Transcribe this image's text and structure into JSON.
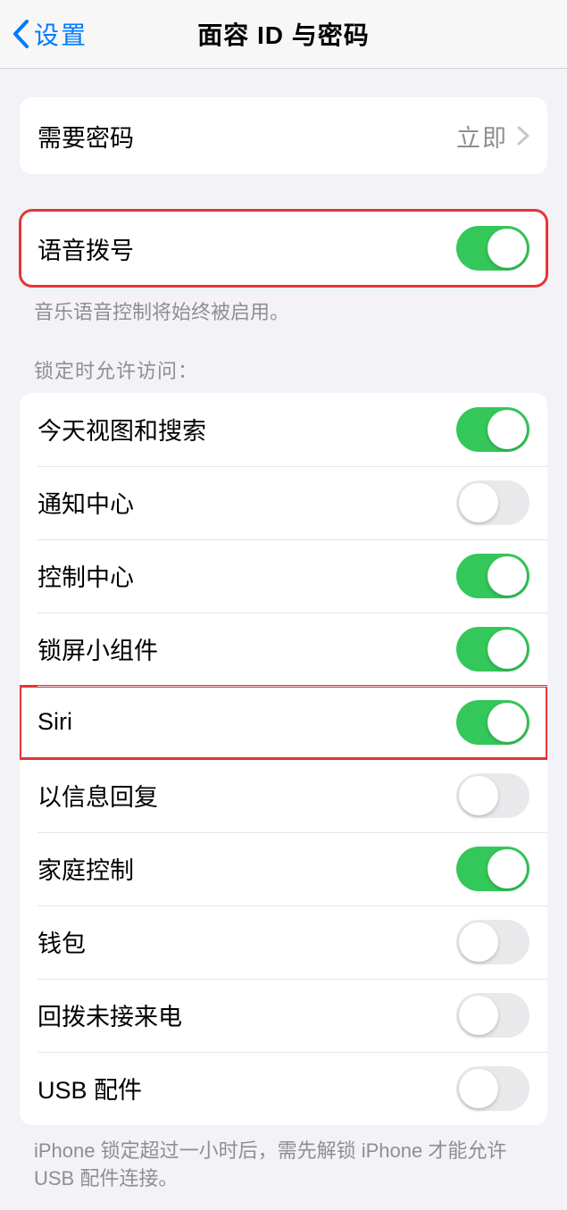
{
  "header": {
    "back_label": "设置",
    "title": "面容 ID 与密码"
  },
  "require_passcode_group": {
    "label": "需要密码",
    "value": "立即"
  },
  "voice_dial_group": {
    "label": "语音拨号",
    "on": true,
    "footer": "音乐语音控制将始终被启用。"
  },
  "locked_access": {
    "header": "锁定时允许访问：",
    "items": [
      {
        "label": "今天视图和搜索",
        "on": true,
        "highlight": false
      },
      {
        "label": "通知中心",
        "on": false,
        "highlight": false
      },
      {
        "label": "控制中心",
        "on": true,
        "highlight": false
      },
      {
        "label": "锁屏小组件",
        "on": true,
        "highlight": false
      },
      {
        "label": "Siri",
        "on": true,
        "highlight": true
      },
      {
        "label": "以信息回复",
        "on": false,
        "highlight": false
      },
      {
        "label": "家庭控制",
        "on": true,
        "highlight": false
      },
      {
        "label": "钱包",
        "on": false,
        "highlight": false
      },
      {
        "label": "回拨未接来电",
        "on": false,
        "highlight": false
      },
      {
        "label": "USB 配件",
        "on": false,
        "highlight": false
      }
    ],
    "footer": "iPhone 锁定超过一小时后，需先解锁 iPhone 才能允许 USB 配件连接。"
  }
}
